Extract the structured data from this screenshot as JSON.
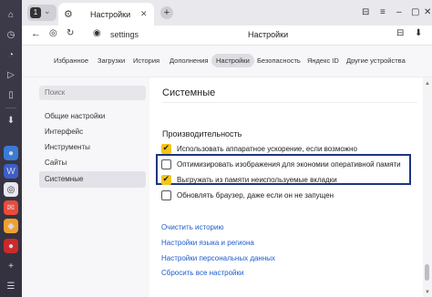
{
  "browser": {
    "tab_group_count": "1",
    "tab_title": "Настройки",
    "address_text": "settings",
    "address_title": "Настройки"
  },
  "top_nav": [
    {
      "label": "Избранное"
    },
    {
      "label": "Загрузки"
    },
    {
      "label": "История"
    },
    {
      "label": "Дополнения"
    },
    {
      "label": "Настройки",
      "active": true
    },
    {
      "label": "Безопасность"
    },
    {
      "label": "Яндекс ID"
    },
    {
      "label": "Другие устройства"
    }
  ],
  "sidebar": {
    "search_placeholder": "Поиск",
    "items": [
      {
        "label": "Общие настройки"
      },
      {
        "label": "Интерфейс"
      },
      {
        "label": "Инструменты"
      },
      {
        "label": "Сайты"
      },
      {
        "label": "Системные",
        "active": true
      }
    ]
  },
  "main": {
    "section_title": "Системные",
    "subsection_title": "Производительность",
    "options": [
      {
        "label": "Использовать аппаратное ускорение, если возможно",
        "checked": true
      },
      {
        "label": "Оптимизировать изображения для экономии оперативной памяти",
        "checked": false
      },
      {
        "label": "Выгружать из памяти неиспользуемые вкладки",
        "checked": true
      },
      {
        "label": "Обновлять браузер, даже если он не запущен",
        "checked": false
      }
    ],
    "links": [
      {
        "label": "Очистить историю"
      },
      {
        "label": "Настройки языка и региона"
      },
      {
        "label": "Настройки персональных данных"
      },
      {
        "label": "Сбросить все настройки"
      }
    ]
  },
  "colors": {
    "accent_checkbox": "#f5c518",
    "link": "#1f5ccc",
    "highlight_border": "#1c3580"
  }
}
